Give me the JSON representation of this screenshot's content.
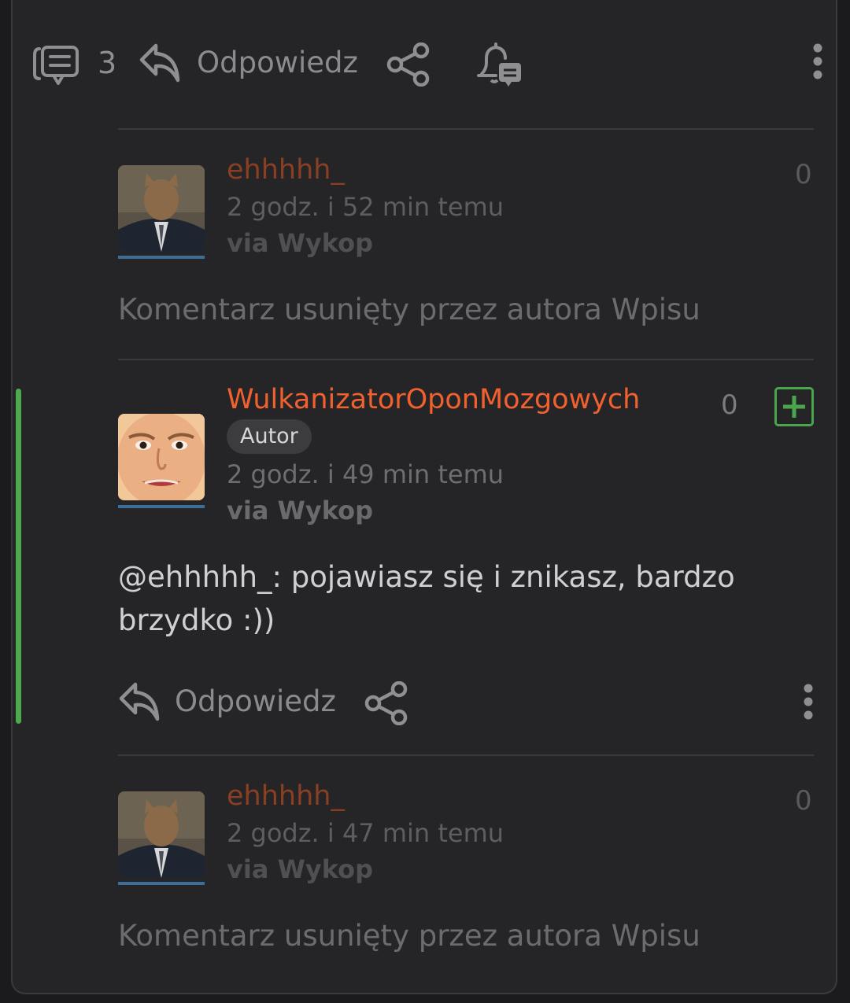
{
  "post_actions": {
    "comment_count": "3",
    "reply_label": "Odpowiedz"
  },
  "colors": {
    "accent_orange": "#f0612f",
    "dim_orange": "#8a3f22",
    "vote_green": "#4aa64a",
    "avatar_underline": "#3b6e98"
  },
  "comments": [
    {
      "username": "ehhhhh_",
      "time": "2 godz. i 52 min temu",
      "via": "via Wykop",
      "score": "0",
      "body": "Komentarz usunięty przez autora Wpisu"
    },
    {
      "username": "WulkanizatorOponMozgowych",
      "badge": "Autor",
      "time": "2 godz. i 49 min temu",
      "via": "via Wykop",
      "score": "0",
      "body": "@ehhhhh_: pojawiasz się i znikasz, bardzo brzydko :))",
      "reply_label": "Odpowiedz"
    },
    {
      "username": "ehhhhh_",
      "time": "2 godz. i 47 min temu",
      "via": "via Wykop",
      "score": "0",
      "body": "Komentarz usunięty przez autora Wpisu"
    }
  ]
}
